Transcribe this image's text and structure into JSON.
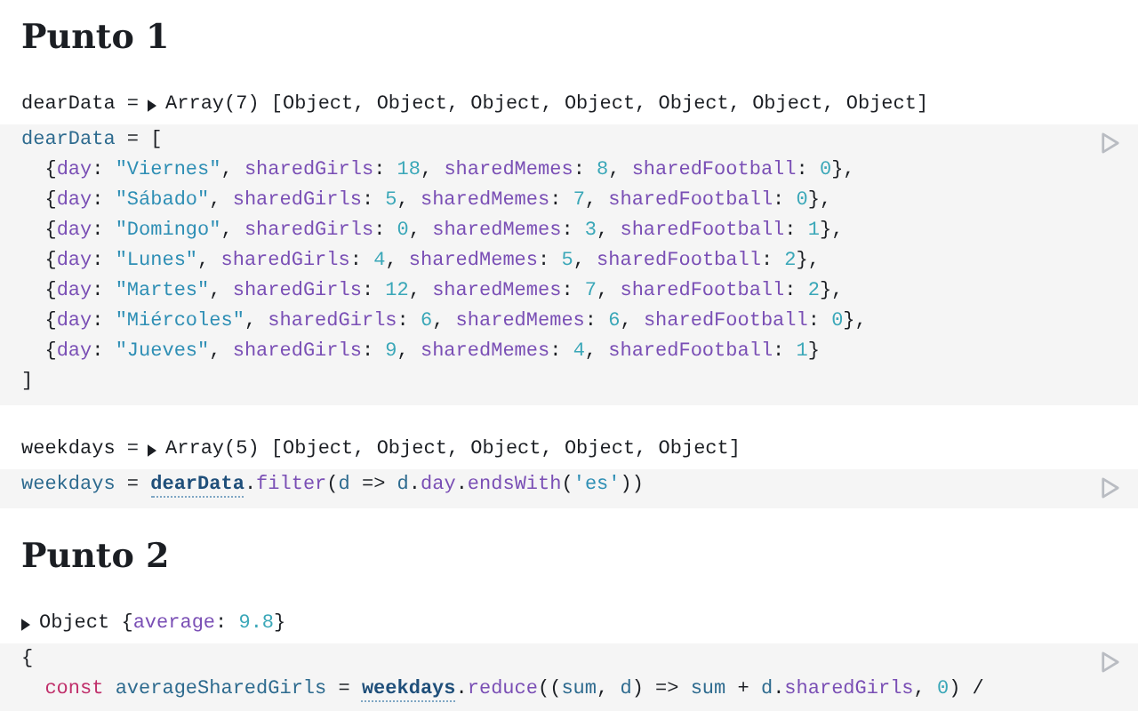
{
  "blocks": [
    {
      "kind": "heading",
      "text": "Punto 1"
    },
    {
      "kind": "output",
      "prefix": "dearData =",
      "expanded": false,
      "tokens": [
        {
          "kind": "plain",
          "text": "Array(7) [Object, Object, Object, Object, Object, Object, Object]"
        }
      ]
    },
    {
      "kind": "code",
      "lines": [
        [
          {
            "kind": "def",
            "text": "dearData"
          },
          {
            "kind": "plain",
            "text": " = ["
          }
        ],
        [
          {
            "kind": "plain",
            "text": "  {"
          },
          {
            "kind": "prop",
            "text": "day"
          },
          {
            "kind": "plain",
            "text": ": "
          },
          {
            "kind": "str",
            "text": "\"Viernes\""
          },
          {
            "kind": "plain",
            "text": ", "
          },
          {
            "kind": "prop",
            "text": "sharedGirls"
          },
          {
            "kind": "plain",
            "text": ": "
          },
          {
            "kind": "num",
            "text": "18"
          },
          {
            "kind": "plain",
            "text": ", "
          },
          {
            "kind": "prop",
            "text": "sharedMemes"
          },
          {
            "kind": "plain",
            "text": ": "
          },
          {
            "kind": "num",
            "text": "8"
          },
          {
            "kind": "plain",
            "text": ", "
          },
          {
            "kind": "prop",
            "text": "sharedFootball"
          },
          {
            "kind": "plain",
            "text": ": "
          },
          {
            "kind": "num",
            "text": "0"
          },
          {
            "kind": "plain",
            "text": "},"
          }
        ],
        [
          {
            "kind": "plain",
            "text": "  {"
          },
          {
            "kind": "prop",
            "text": "day"
          },
          {
            "kind": "plain",
            "text": ": "
          },
          {
            "kind": "str",
            "text": "\"Sábado\""
          },
          {
            "kind": "plain",
            "text": ", "
          },
          {
            "kind": "prop",
            "text": "sharedGirls"
          },
          {
            "kind": "plain",
            "text": ": "
          },
          {
            "kind": "num",
            "text": "5"
          },
          {
            "kind": "plain",
            "text": ", "
          },
          {
            "kind": "prop",
            "text": "sharedMemes"
          },
          {
            "kind": "plain",
            "text": ": "
          },
          {
            "kind": "num",
            "text": "7"
          },
          {
            "kind": "plain",
            "text": ", "
          },
          {
            "kind": "prop",
            "text": "sharedFootball"
          },
          {
            "kind": "plain",
            "text": ": "
          },
          {
            "kind": "num",
            "text": "0"
          },
          {
            "kind": "plain",
            "text": "},"
          }
        ],
        [
          {
            "kind": "plain",
            "text": "  {"
          },
          {
            "kind": "prop",
            "text": "day"
          },
          {
            "kind": "plain",
            "text": ": "
          },
          {
            "kind": "str",
            "text": "\"Domingo\""
          },
          {
            "kind": "plain",
            "text": ", "
          },
          {
            "kind": "prop",
            "text": "sharedGirls"
          },
          {
            "kind": "plain",
            "text": ": "
          },
          {
            "kind": "num",
            "text": "0"
          },
          {
            "kind": "plain",
            "text": ", "
          },
          {
            "kind": "prop",
            "text": "sharedMemes"
          },
          {
            "kind": "plain",
            "text": ": "
          },
          {
            "kind": "num",
            "text": "3"
          },
          {
            "kind": "plain",
            "text": ", "
          },
          {
            "kind": "prop",
            "text": "sharedFootball"
          },
          {
            "kind": "plain",
            "text": ": "
          },
          {
            "kind": "num",
            "text": "1"
          },
          {
            "kind": "plain",
            "text": "},"
          }
        ],
        [
          {
            "kind": "plain",
            "text": "  {"
          },
          {
            "kind": "prop",
            "text": "day"
          },
          {
            "kind": "plain",
            "text": ": "
          },
          {
            "kind": "str",
            "text": "\"Lunes\""
          },
          {
            "kind": "plain",
            "text": ", "
          },
          {
            "kind": "prop",
            "text": "sharedGirls"
          },
          {
            "kind": "plain",
            "text": ": "
          },
          {
            "kind": "num",
            "text": "4"
          },
          {
            "kind": "plain",
            "text": ", "
          },
          {
            "kind": "prop",
            "text": "sharedMemes"
          },
          {
            "kind": "plain",
            "text": ": "
          },
          {
            "kind": "num",
            "text": "5"
          },
          {
            "kind": "plain",
            "text": ", "
          },
          {
            "kind": "prop",
            "text": "sharedFootball"
          },
          {
            "kind": "plain",
            "text": ": "
          },
          {
            "kind": "num",
            "text": "2"
          },
          {
            "kind": "plain",
            "text": "},"
          }
        ],
        [
          {
            "kind": "plain",
            "text": "  {"
          },
          {
            "kind": "prop",
            "text": "day"
          },
          {
            "kind": "plain",
            "text": ": "
          },
          {
            "kind": "str",
            "text": "\"Martes\""
          },
          {
            "kind": "plain",
            "text": ", "
          },
          {
            "kind": "prop",
            "text": "sharedGirls"
          },
          {
            "kind": "plain",
            "text": ": "
          },
          {
            "kind": "num",
            "text": "12"
          },
          {
            "kind": "plain",
            "text": ", "
          },
          {
            "kind": "prop",
            "text": "sharedMemes"
          },
          {
            "kind": "plain",
            "text": ": "
          },
          {
            "kind": "num",
            "text": "7"
          },
          {
            "kind": "plain",
            "text": ", "
          },
          {
            "kind": "prop",
            "text": "sharedFootball"
          },
          {
            "kind": "plain",
            "text": ": "
          },
          {
            "kind": "num",
            "text": "2"
          },
          {
            "kind": "plain",
            "text": "},"
          }
        ],
        [
          {
            "kind": "plain",
            "text": "  {"
          },
          {
            "kind": "prop",
            "text": "day"
          },
          {
            "kind": "plain",
            "text": ": "
          },
          {
            "kind": "str",
            "text": "\"Miércoles\""
          },
          {
            "kind": "plain",
            "text": ", "
          },
          {
            "kind": "prop",
            "text": "sharedGirls"
          },
          {
            "kind": "plain",
            "text": ": "
          },
          {
            "kind": "num",
            "text": "6"
          },
          {
            "kind": "plain",
            "text": ", "
          },
          {
            "kind": "prop",
            "text": "sharedMemes"
          },
          {
            "kind": "plain",
            "text": ": "
          },
          {
            "kind": "num",
            "text": "6"
          },
          {
            "kind": "plain",
            "text": ", "
          },
          {
            "kind": "prop",
            "text": "sharedFootball"
          },
          {
            "kind": "plain",
            "text": ": "
          },
          {
            "kind": "num",
            "text": "0"
          },
          {
            "kind": "plain",
            "text": "},"
          }
        ],
        [
          {
            "kind": "plain",
            "text": "  {"
          },
          {
            "kind": "prop",
            "text": "day"
          },
          {
            "kind": "plain",
            "text": ": "
          },
          {
            "kind": "str",
            "text": "\"Jueves\""
          },
          {
            "kind": "plain",
            "text": ", "
          },
          {
            "kind": "prop",
            "text": "sharedGirls"
          },
          {
            "kind": "plain",
            "text": ": "
          },
          {
            "kind": "num",
            "text": "9"
          },
          {
            "kind": "plain",
            "text": ", "
          },
          {
            "kind": "prop",
            "text": "sharedMemes"
          },
          {
            "kind": "plain",
            "text": ": "
          },
          {
            "kind": "num",
            "text": "4"
          },
          {
            "kind": "plain",
            "text": ", "
          },
          {
            "kind": "prop",
            "text": "sharedFootball"
          },
          {
            "kind": "plain",
            "text": ": "
          },
          {
            "kind": "num",
            "text": "1"
          },
          {
            "kind": "plain",
            "text": "}"
          }
        ],
        [
          {
            "kind": "plain",
            "text": "]"
          }
        ]
      ]
    },
    {
      "kind": "output",
      "prefix": "weekdays =",
      "expanded": false,
      "tokens": [
        {
          "kind": "plain",
          "text": "Array(5) [Object, Object, Object, Object, Object]"
        }
      ]
    },
    {
      "kind": "code",
      "lines": [
        [
          {
            "kind": "def",
            "text": "weekdays"
          },
          {
            "kind": "plain",
            "text": " = "
          },
          {
            "kind": "link",
            "text": "dearData"
          },
          {
            "kind": "plain",
            "text": "."
          },
          {
            "kind": "prop",
            "text": "filter"
          },
          {
            "kind": "plain",
            "text": "("
          },
          {
            "kind": "def",
            "text": "d"
          },
          {
            "kind": "plain",
            "text": " => "
          },
          {
            "kind": "def",
            "text": "d"
          },
          {
            "kind": "plain",
            "text": "."
          },
          {
            "kind": "prop",
            "text": "day"
          },
          {
            "kind": "plain",
            "text": "."
          },
          {
            "kind": "prop",
            "text": "endsWith"
          },
          {
            "kind": "plain",
            "text": "("
          },
          {
            "kind": "str",
            "text": "'es'"
          },
          {
            "kind": "plain",
            "text": "))"
          }
        ]
      ]
    },
    {
      "kind": "heading",
      "text": "Punto 2"
    },
    {
      "kind": "output",
      "expanded": false,
      "tokens": [
        {
          "kind": "plain",
          "text": "Object {"
        },
        {
          "kind": "prop",
          "text": "average"
        },
        {
          "kind": "plain",
          "text": ": "
        },
        {
          "kind": "num",
          "text": "9.8"
        },
        {
          "kind": "plain",
          "text": "}"
        }
      ]
    },
    {
      "kind": "code",
      "lines": [
        [
          {
            "kind": "plain",
            "text": "{"
          }
        ],
        [
          {
            "kind": "kw",
            "text": "  const"
          },
          {
            "kind": "def",
            "text": " averageSharedGirls"
          },
          {
            "kind": "plain",
            "text": " = "
          },
          {
            "kind": "link",
            "text": "weekdays"
          },
          {
            "kind": "plain",
            "text": "."
          },
          {
            "kind": "prop",
            "text": "reduce"
          },
          {
            "kind": "plain",
            "text": "(("
          },
          {
            "kind": "def",
            "text": "sum"
          },
          {
            "kind": "plain",
            "text": ", "
          },
          {
            "kind": "def",
            "text": "d"
          },
          {
            "kind": "plain",
            "text": ") => "
          },
          {
            "kind": "def",
            "text": "sum"
          },
          {
            "kind": "plain",
            "text": " + "
          },
          {
            "kind": "def",
            "text": "d"
          },
          {
            "kind": "plain",
            "text": "."
          },
          {
            "kind": "prop",
            "text": "sharedGirls"
          },
          {
            "kind": "plain",
            "text": ", "
          },
          {
            "kind": "num",
            "text": "0"
          },
          {
            "kind": "plain",
            "text": ") /"
          }
        ]
      ]
    }
  ]
}
